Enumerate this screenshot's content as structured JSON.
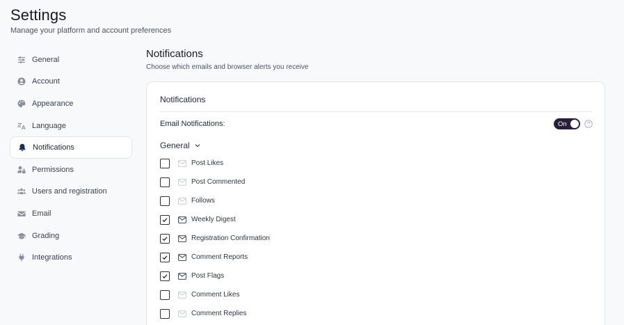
{
  "header": {
    "title": "Settings",
    "subtitle": "Manage your platform and account preferences"
  },
  "sidebar": {
    "items": [
      {
        "label": "General",
        "icon": "sliders-icon",
        "active": false
      },
      {
        "label": "Account",
        "icon": "user-circle-icon",
        "active": false
      },
      {
        "label": "Appearance",
        "icon": "palette-icon",
        "active": false
      },
      {
        "label": "Language",
        "icon": "translate-icon",
        "active": false
      },
      {
        "label": "Notifications",
        "icon": "bell-icon",
        "active": true
      },
      {
        "label": "Permissions",
        "icon": "user-lock-icon",
        "active": false
      },
      {
        "label": "Users and registration",
        "icon": "users-icon",
        "active": false
      },
      {
        "label": "Email",
        "icon": "envelope-icon",
        "active": false
      },
      {
        "label": "Grading",
        "icon": "graduation-cap-icon",
        "active": false
      },
      {
        "label": "Integrations",
        "icon": "plug-icon",
        "active": false
      }
    ]
  },
  "section": {
    "title": "Notifications",
    "description": "Choose which emails and browser alerts you receive"
  },
  "card": {
    "title": "Notifications",
    "email_label": "Email Notifications:",
    "toggle_label": "On",
    "group_label": "General",
    "items": [
      {
        "label": "Post Likes",
        "checked": false
      },
      {
        "label": "Post Commented",
        "checked": false
      },
      {
        "label": "Follows",
        "checked": false
      },
      {
        "label": "Weekly Digest",
        "checked": true
      },
      {
        "label": "Registration Confirmation",
        "checked": true
      },
      {
        "label": "Comment Reports",
        "checked": true
      },
      {
        "label": "Post Flags",
        "checked": true
      },
      {
        "label": "Comment Likes",
        "checked": false
      },
      {
        "label": "Comment Replies",
        "checked": false
      }
    ]
  },
  "colors": {
    "toggle_bg": "#2a1e3a",
    "active_icon": "#1c2b5a"
  }
}
